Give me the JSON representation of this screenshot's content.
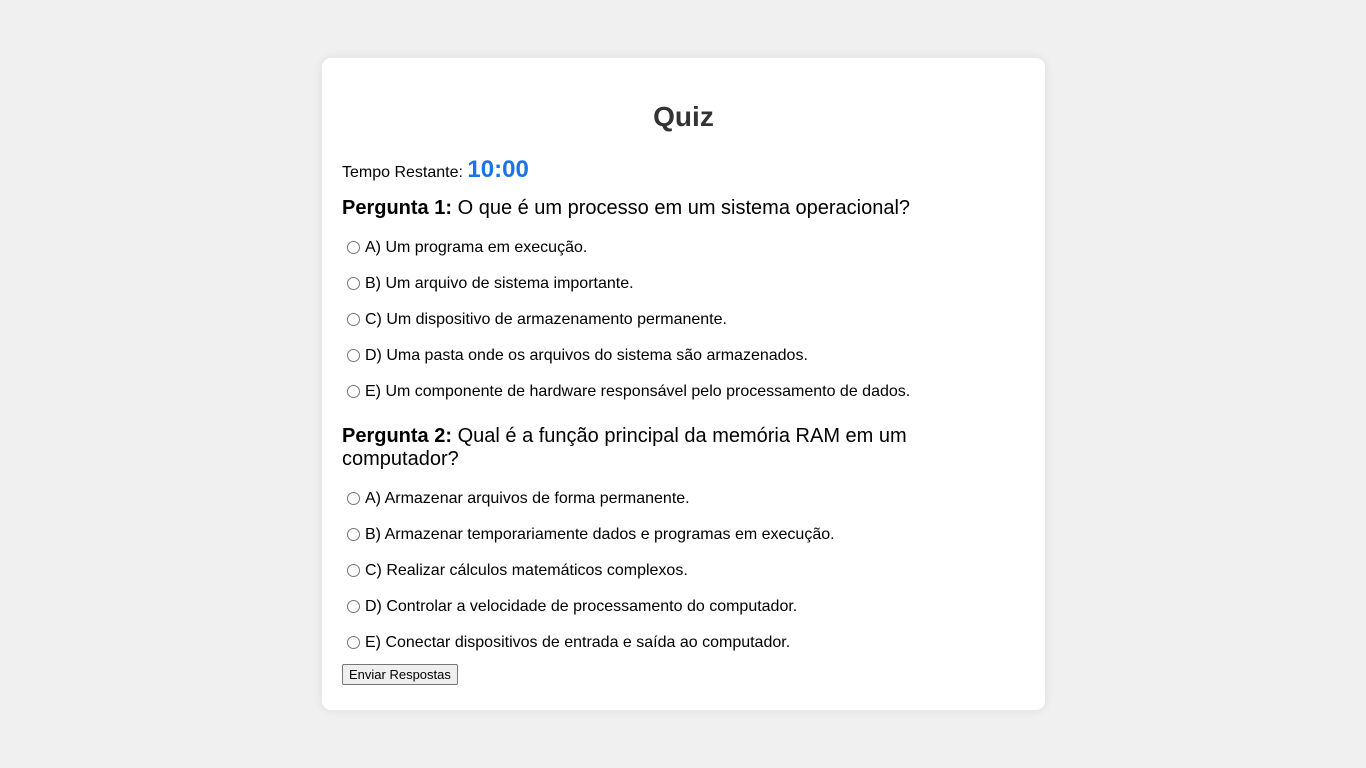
{
  "quiz": {
    "title": "Quiz",
    "timer": {
      "label": "Tempo Restante: ",
      "value": "10:00",
      "color": "#1a73e8"
    },
    "questions": [
      {
        "number_label": "Pergunta 1:",
        "text": " O que é um processo em um sistema operacional?",
        "options": [
          "A) Um programa em execução.",
          "B) Um arquivo de sistema importante.",
          "C) Um dispositivo de armazenamento permanente.",
          "D) Uma pasta onde os arquivos do sistema são armazenados.",
          "E) Um componente de hardware responsável pelo processamento de dados."
        ]
      },
      {
        "number_label": "Pergunta 2:",
        "text": " Qual é a função principal da memória RAM em um computador?",
        "options": [
          "A) Armazenar arquivos de forma permanente.",
          "B) Armazenar temporariamente dados e programas em execução.",
          "C) Realizar cálculos matemáticos complexos.",
          "D) Controlar a velocidade de processamento do computador.",
          "E) Conectar dispositivos de entrada e saída ao computador."
        ]
      }
    ],
    "submit_label": "Enviar Respostas"
  }
}
